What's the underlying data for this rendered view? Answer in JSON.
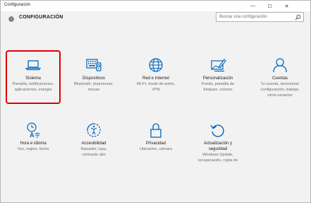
{
  "window": {
    "title": "Configuración",
    "minimize_glyph": "—",
    "maximize_glyph": "☐",
    "close_glyph": "✕"
  },
  "header": {
    "title": "CONFIGURACIÓN",
    "icon": "gear-icon"
  },
  "search": {
    "placeholder": "Buscar una configuración",
    "icon": "search-icon"
  },
  "accent_color": "#0067c0",
  "highlight_color": "#e00000",
  "tiles": [
    {
      "label": "Sistema",
      "desc_1": "Pantalla, notificaciones,",
      "desc_2": "aplicaciones, energía",
      "desc_3": "",
      "icon": "laptop-icon",
      "selected": true
    },
    {
      "label": "Dispositivos",
      "desc_1": "Bluetooth, impresoras,",
      "desc_2": "mouse",
      "desc_3": "",
      "icon": "devices-icon"
    },
    {
      "label": "Red e Internet",
      "desc_1": "Wi-Fi, modo de avión,",
      "desc_2": "VPN",
      "desc_3": "",
      "icon": "globe-icon"
    },
    {
      "label": "Personalización",
      "desc_1": "Fondo, pantalla de",
      "desc_2": "bloqueo, colores",
      "desc_3": "",
      "icon": "personalization-icon"
    },
    {
      "label": "Cuentas",
      "desc_1": "Tu cuenta, sincronizar",
      "desc_2": "configuración, trabajo,",
      "desc_3": "otros usuarios",
      "icon": "person-icon"
    },
    {
      "label": "Hora e idioma",
      "desc_1": "Voz, región, fecha",
      "desc_2": "",
      "desc_3": "",
      "icon": "time-language-icon"
    },
    {
      "label": "Accesibilidad",
      "desc_1": "Narrador, lupa,",
      "desc_2": "contraste alto",
      "desc_3": "",
      "icon": "accessibility-icon"
    },
    {
      "label": "Privacidad",
      "desc_1": "Ubicación, cámara",
      "desc_2": "",
      "desc_3": "",
      "icon": "lock-icon"
    },
    {
      "label": "Actualización y",
      "label_2": "seguridad",
      "desc_1": "Windows Update,",
      "desc_2": "recuperación, copia de",
      "desc_3": "",
      "icon": "update-icon"
    }
  ]
}
